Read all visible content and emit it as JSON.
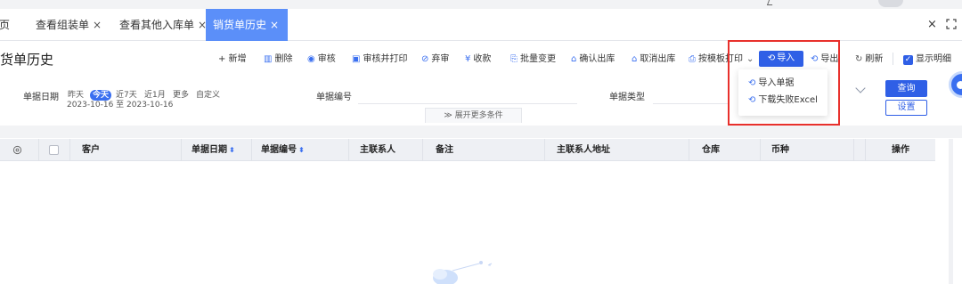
{
  "tabs": [
    {
      "label": "页",
      "closable": false,
      "active": false
    },
    {
      "label": "查看组装单",
      "closable": true,
      "active": false
    },
    {
      "label": "查看其他入库单",
      "closable": true,
      "active": false
    },
    {
      "label": "销货单历史",
      "closable": true,
      "active": true
    }
  ],
  "tab_close_glyph": "×",
  "page_title": "货单历史",
  "toolbar": {
    "add": "+ 新增",
    "delete": "删除",
    "audit": "审核",
    "audit_print": "审核并打印",
    "abandon": "弃审",
    "receive": "收款",
    "batch_change": "批量变更",
    "confirm_out": "确认出库",
    "cancel_out": "取消出库",
    "template_print": "按模板打印",
    "import": "导入",
    "export": "导出",
    "refresh": "刷新",
    "show_detail": "显示明细"
  },
  "import_menu": {
    "import_doc": "导入单据",
    "download_failed": "下载失败Excel"
  },
  "filters": {
    "date_label": "单据日期",
    "date_options": [
      "昨天",
      "今天",
      "近7天",
      "近1月",
      "更多",
      "自定义"
    ],
    "date_selected": "今天",
    "date_range": "2023-10-16 至 2023-10-16",
    "doc_no_label": "单据编号",
    "doc_type_label": "单据类型",
    "expand_more": "展开更多条件",
    "query_button": "查询",
    "settings_button": "设置"
  },
  "table": {
    "columns": [
      {
        "label": "客户",
        "sortable": false
      },
      {
        "label": "单据日期",
        "sortable": true
      },
      {
        "label": "单据编号",
        "sortable": true
      },
      {
        "label": "主联系人",
        "sortable": false
      },
      {
        "label": "备注",
        "sortable": false
      },
      {
        "label": "主联系人地址",
        "sortable": false
      },
      {
        "label": "仓库",
        "sortable": false
      },
      {
        "label": "币种",
        "sortable": false
      },
      {
        "label": "操作",
        "sortable": false
      }
    ],
    "sort_glyph": "▲▼"
  },
  "colors": {
    "accent": "#2f5fe6",
    "active_tab": "#5b8ff9",
    "highlight_border": "#e8302c"
  }
}
